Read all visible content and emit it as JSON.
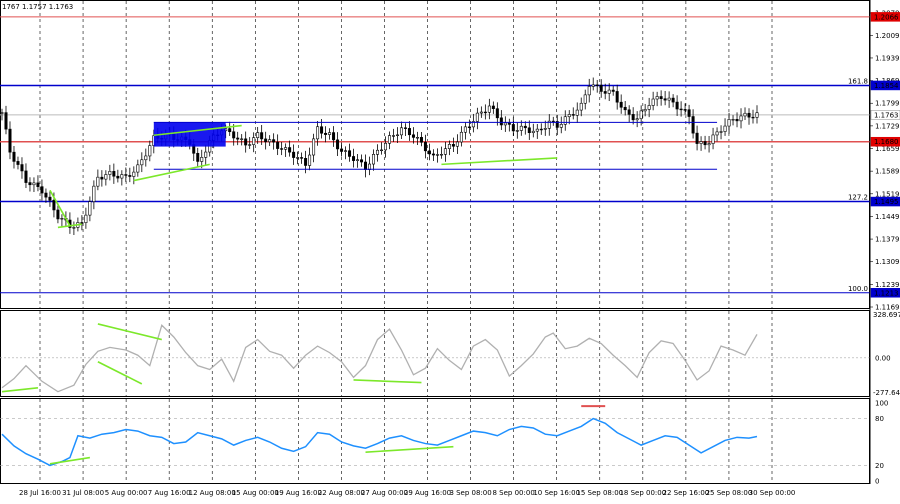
{
  "header": {
    "ohlc_text": "1767 1.1757 1.1763"
  },
  "colors": {
    "background": "#ffffff",
    "grid": "#000000",
    "candle": "#000000",
    "support_resistance_red": "#e05050",
    "fib_blue": "#0000cc",
    "price_tag_red": "#e00000",
    "price_tag_blue": "#0000cc",
    "price_tag_gray": "#ffffff",
    "divergence_green": "#7ce82a",
    "cci_line": "#b0b0b0",
    "rsi_line": "#1e90ff",
    "rsi_marker_red": "#e05050"
  },
  "chart_data": [
    {
      "type": "candlestick",
      "panel": "price",
      "ylim": [
        1.1169,
        1.2078
      ],
      "y_ticks": [
        "1.2078",
        "1.2009",
        "1.1939",
        "1.1869",
        "1.1799",
        "1.1729",
        "1.1659",
        "1.1589",
        "1.1519",
        "1.1449",
        "1.1379",
        "1.1309",
        "1.1239",
        "1.1169"
      ],
      "x_ticks": [
        "28 Jul 16:00",
        "31 Jul 08:00",
        "5 Aug 00:00",
        "7 Aug 16:00",
        "12 Aug 08:00",
        "15 Aug 00:00",
        "19 Aug 16:00",
        "22 Aug 08:00",
        "27 Aug 00:00",
        "29 Aug 16:00",
        "3 Sep 08:00",
        "8 Sep 00:00",
        "10 Sep 16:00",
        "15 Sep 08:00",
        "18 Sep 00:00",
        "22 Sep 16:00",
        "25 Sep 08:00",
        "30 Sep 00:00"
      ],
      "close_path": [
        [
          0,
          1.177
        ],
        [
          2,
          1.165
        ],
        [
          6,
          1.156
        ],
        [
          10,
          1.153
        ],
        [
          14,
          1.145
        ],
        [
          17,
          1.142
        ],
        [
          20,
          1.1425
        ],
        [
          24,
          1.157
        ],
        [
          27,
          1.158
        ],
        [
          31,
          1.157
        ],
        [
          34,
          1.16
        ],
        [
          38,
          1.169
        ],
        [
          41,
          1.17
        ],
        [
          44,
          1.169
        ],
        [
          47,
          1.168
        ],
        [
          49,
          1.161
        ],
        [
          52,
          1.168
        ],
        [
          55,
          1.172
        ],
        [
          58,
          1.17
        ],
        [
          61,
          1.167
        ],
        [
          64,
          1.17
        ],
        [
          67,
          1.168
        ],
        [
          70,
          1.166
        ],
        [
          73,
          1.164
        ],
        [
          76,
          1.161
        ],
        [
          79,
          1.172
        ],
        [
          82,
          1.17
        ],
        [
          85,
          1.165
        ],
        [
          88,
          1.163
        ],
        [
          91,
          1.16
        ],
        [
          94,
          1.165
        ],
        [
          97,
          1.169
        ],
        [
          100,
          1.172
        ],
        [
          103,
          1.17
        ],
        [
          106,
          1.166
        ],
        [
          108,
          1.163
        ],
        [
          110,
          1.165
        ],
        [
          113,
          1.167
        ],
        [
          116,
          1.172
        ],
        [
          119,
          1.176
        ],
        [
          122,
          1.179
        ],
        [
          125,
          1.174
        ],
        [
          128,
          1.172
        ],
        [
          131,
          1.172
        ],
        [
          134,
          1.171
        ],
        [
          137,
          1.174
        ],
        [
          139,
          1.173
        ],
        [
          142,
          1.176
        ],
        [
          145,
          1.179
        ],
        [
          147,
          1.186
        ],
        [
          150,
          1.184
        ],
        [
          153,
          1.183
        ],
        [
          156,
          1.177
        ],
        [
          159,
          1.175
        ],
        [
          162,
          1.18
        ],
        [
          165,
          1.182
        ],
        [
          168,
          1.18
        ],
        [
          170,
          1.178
        ],
        [
          172,
          1.176
        ],
        [
          174,
          1.167
        ],
        [
          177,
          1.168
        ],
        [
          180,
          1.172
        ],
        [
          183,
          1.175
        ],
        [
          186,
          1.176
        ],
        [
          189,
          1.1763
        ]
      ],
      "horizontal_levels": [
        {
          "value": 1.2066,
          "label": "1.2066",
          "tag_color": "#e00000",
          "line_color": "#e05050",
          "line_width": 1
        },
        {
          "value": 1.1854,
          "label": "1.1854",
          "fib_label": "161.8",
          "tag_color": "#0000cc",
          "line_color": "#0000cc",
          "line_width": 1.5
        },
        {
          "value": 1.1763,
          "label": "1.1763",
          "tag_color": "#ffffff",
          "line_color": "#bbbbbb",
          "line_width": 1
        },
        {
          "value": 1.168,
          "label": "1.1680",
          "tag_color": "#e00000",
          "line_color": "#e05050",
          "line_width": 1.5
        },
        {
          "value": 1.1495,
          "label": "1.1495",
          "fib_label": "127.2",
          "tag_color": "#0000cc",
          "line_color": "#0000cc",
          "line_width": 1.5
        },
        {
          "value": 1.1213,
          "label": "1.1213",
          "fib_label": "100.0",
          "tag_color": "#0000cc",
          "line_color": "#0000cc",
          "line_width": 1
        }
      ],
      "channel": {
        "upper": 1.174,
        "lower": 1.1595,
        "start": 38,
        "end": 179
      },
      "blue_box": {
        "x_from": 38,
        "x_to": 56,
        "y_from": 1.1665,
        "y_to": 1.174
      },
      "divergence_lines": [
        [
          [
            14,
            1.1415
          ],
          [
            20,
            1.1425
          ]
        ],
        [
          [
            17,
            1.142
          ],
          [
            12,
            1.153
          ]
        ],
        [
          [
            33,
            1.156
          ],
          [
            52,
            1.161
          ]
        ],
        [
          [
            38,
            1.17
          ],
          [
            60,
            1.173
          ]
        ],
        [
          [
            110,
            1.161
          ],
          [
            139,
            1.163
          ]
        ]
      ]
    },
    {
      "type": "line",
      "panel": "CCI",
      "ylim": [
        -277.6448,
        328.6976
      ],
      "y_ticks": [
        "328.6976",
        "0.00",
        "-277.6448"
      ],
      "series": [
        {
          "values": [
            [
              0,
              -230
            ],
            [
              3,
              -160
            ],
            [
              6,
              -60
            ],
            [
              10,
              -180
            ],
            [
              14,
              -260
            ],
            [
              18,
              -210
            ],
            [
              21,
              -50
            ],
            [
              24,
              50
            ],
            [
              27,
              80
            ],
            [
              31,
              60
            ],
            [
              34,
              20
            ],
            [
              37,
              -60
            ],
            [
              40,
              250
            ],
            [
              43,
              160
            ],
            [
              46,
              40
            ],
            [
              49,
              -60
            ],
            [
              52,
              -90
            ],
            [
              55,
              -10
            ],
            [
              58,
              -180
            ],
            [
              61,
              80
            ],
            [
              64,
              140
            ],
            [
              67,
              50
            ],
            [
              70,
              20
            ],
            [
              73,
              -80
            ],
            [
              76,
              20
            ],
            [
              79,
              90
            ],
            [
              82,
              40
            ],
            [
              85,
              -30
            ],
            [
              88,
              -150
            ],
            [
              91,
              -60
            ],
            [
              94,
              140
            ],
            [
              97,
              220
            ],
            [
              100,
              60
            ],
            [
              103,
              -130
            ],
            [
              106,
              -80
            ],
            [
              109,
              70
            ],
            [
              112,
              -20
            ],
            [
              115,
              -90
            ],
            [
              118,
              90
            ],
            [
              121,
              140
            ],
            [
              124,
              60
            ],
            [
              127,
              -140
            ],
            [
              130,
              -60
            ],
            [
              133,
              30
            ],
            [
              136,
              160
            ],
            [
              138,
              190
            ],
            [
              141,
              70
            ],
            [
              144,
              90
            ],
            [
              147,
              150
            ],
            [
              150,
              110
            ],
            [
              153,
              20
            ],
            [
              156,
              -60
            ],
            [
              159,
              -150
            ],
            [
              162,
              40
            ],
            [
              165,
              130
            ],
            [
              168,
              110
            ],
            [
              171,
              -20
            ],
            [
              174,
              -170
            ],
            [
              177,
              -100
            ],
            [
              180,
              90
            ],
            [
              183,
              60
            ],
            [
              186,
              20
            ],
            [
              189,
              180
            ]
          ]
        }
      ],
      "divergence_lines": [
        [
          [
            0,
            -260
          ],
          [
            9,
            -230
          ]
        ],
        [
          [
            24,
            -30
          ],
          [
            35,
            -200
          ]
        ],
        [
          [
            24,
            260
          ],
          [
            40,
            140
          ]
        ],
        [
          [
            88,
            -170
          ],
          [
            105,
            -190
          ]
        ]
      ]
    },
    {
      "type": "line",
      "panel": "RSI",
      "ylim": [
        0,
        100
      ],
      "y_ticks": [
        "100",
        "80",
        "20",
        "0"
      ],
      "levels": [
        80,
        20
      ],
      "series": [
        {
          "values": [
            [
              0,
              60
            ],
            [
              3,
              45
            ],
            [
              6,
              35
            ],
            [
              9,
              28
            ],
            [
              12,
              20
            ],
            [
              15,
              25
            ],
            [
              17,
              30
            ],
            [
              19,
              58
            ],
            [
              22,
              55
            ],
            [
              25,
              60
            ],
            [
              28,
              62
            ],
            [
              31,
              66
            ],
            [
              34,
              64
            ],
            [
              37,
              58
            ],
            [
              40,
              56
            ],
            [
              43,
              48
            ],
            [
              46,
              50
            ],
            [
              49,
              62
            ],
            [
              52,
              58
            ],
            [
              55,
              54
            ],
            [
              58,
              46
            ],
            [
              61,
              52
            ],
            [
              64,
              56
            ],
            [
              67,
              50
            ],
            [
              70,
              42
            ],
            [
              73,
              38
            ],
            [
              76,
              44
            ],
            [
              79,
              62
            ],
            [
              82,
              60
            ],
            [
              85,
              50
            ],
            [
              88,
              45
            ],
            [
              91,
              42
            ],
            [
              94,
              48
            ],
            [
              97,
              55
            ],
            [
              100,
              58
            ],
            [
              103,
              52
            ],
            [
              106,
              48
            ],
            [
              109,
              46
            ],
            [
              112,
              52
            ],
            [
              115,
              58
            ],
            [
              118,
              64
            ],
            [
              121,
              62
            ],
            [
              124,
              58
            ],
            [
              127,
              66
            ],
            [
              130,
              70
            ],
            [
              133,
              68
            ],
            [
              136,
              60
            ],
            [
              139,
              58
            ],
            [
              142,
              64
            ],
            [
              145,
              70
            ],
            [
              148,
              80
            ],
            [
              151,
              74
            ],
            [
              154,
              62
            ],
            [
              157,
              54
            ],
            [
              160,
              46
            ],
            [
              163,
              52
            ],
            [
              166,
              58
            ],
            [
              169,
              56
            ],
            [
              172,
              46
            ],
            [
              175,
              36
            ],
            [
              178,
              44
            ],
            [
              181,
              52
            ],
            [
              184,
              56
            ],
            [
              187,
              55
            ],
            [
              189,
              57
            ]
          ]
        }
      ],
      "divergence_lines": [
        [
          [
            12,
            22
          ],
          [
            22,
            30
          ]
        ],
        [
          [
            91,
            37
          ],
          [
            113,
            44
          ]
        ]
      ],
      "marker": {
        "x_from": 145,
        "x_to": 151,
        "value": 96
      }
    }
  ]
}
